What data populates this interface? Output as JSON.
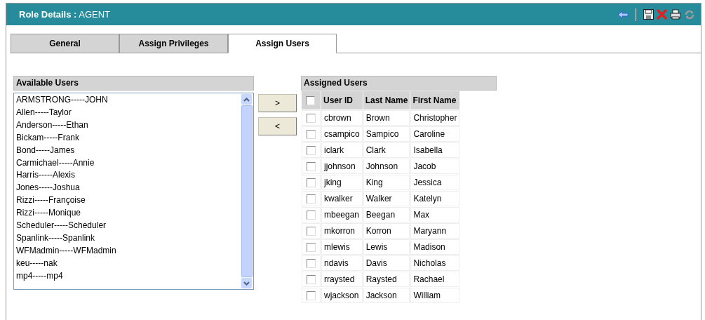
{
  "header": {
    "title": "**Role Details :** AGENT"
  },
  "tabs": [
    {
      "label": "General",
      "selected": false
    },
    {
      "label": "Assign Privileges",
      "selected": false
    },
    {
      "label": "Assign Users",
      "selected": true
    }
  ],
  "available_users": {
    "heading": "Available Users",
    "items": [
      "ARMSTRONG-----JOHN",
      "Allen-----Taylor",
      "Anderson-----Ethan",
      "Bickam-----Frank",
      "Bond-----James",
      "Carmichael-----Annie",
      "Harris-----Alexis",
      "Jones-----Joshua",
      "Rizzi-----Françoise",
      "Rizzi-----Monique",
      "Scheduler-----Scheduler",
      "Spanlink-----Spanlink",
      "WFMadmin-----WFMadmin",
      "keu-----nak",
      "mp4-----mp4"
    ]
  },
  "transfer_buttons": [
    ">",
    "<"
  ],
  "assigned_users": {
    "heading": "Assigned Users",
    "select_all_checked": false,
    "columns": [
      "User ID",
      "Last Name",
      "First Name"
    ],
    "rows": [
      {
        "cells": [
          "cbrown",
          "Brown",
          "Christopher"
        ],
        "checked": false
      },
      {
        "cells": [
          "csampico",
          "Sampico",
          "Caroline"
        ],
        "checked": false
      },
      {
        "cells": [
          "iclark",
          "Clark",
          "Isabella"
        ],
        "checked": false
      },
      {
        "cells": [
          "jjohnson",
          "Johnson",
          "Jacob"
        ],
        "checked": false
      },
      {
        "cells": [
          "jking",
          "King",
          "Jessica"
        ],
        "checked": false
      },
      {
        "cells": [
          "kwalker",
          "Walker",
          "Katelyn"
        ],
        "checked": false
      },
      {
        "cells": [
          "mbeegan",
          "Beegan",
          "Max"
        ],
        "checked": false
      },
      {
        "cells": [
          "mkorron",
          "Korron",
          "Maryann"
        ],
        "checked": false
      },
      {
        "cells": [
          "mlewis",
          "Lewis",
          "Madison"
        ],
        "checked": false
      },
      {
        "cells": [
          "ndavis",
          "Davis",
          "Nicholas"
        ],
        "checked": false
      },
      {
        "cells": [
          "rraysted",
          "Raysted",
          "Rachael"
        ],
        "checked": false
      },
      {
        "cells": [
          "wjackson",
          "Jackson",
          "William"
        ],
        "checked": false
      }
    ]
  }
}
